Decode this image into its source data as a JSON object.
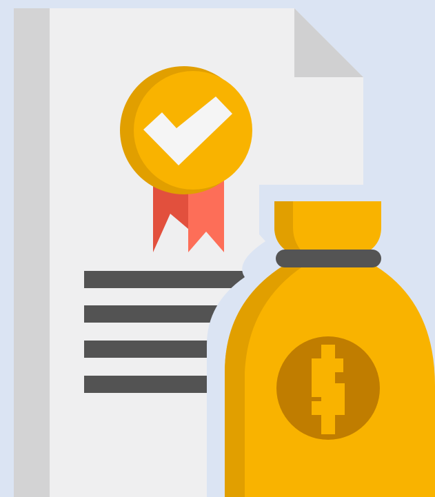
{
  "illustration": {
    "icons": [
      "certificate-document-icon",
      "approval-check-badge-icon",
      "ribbon-icon",
      "money-bag-icon",
      "dollar-coin-icon"
    ],
    "text_lines_on_document": 4,
    "colors": {
      "background": "#dbe4f3",
      "paper": "#efeff0",
      "paper_spine": "#d3d3d4",
      "paper_fold": "#d0d0d1",
      "text_line": "#535353",
      "badge_gold": "#f9b300",
      "badge_gold_shadow": "#e19f00",
      "check_white": "#f5f5f5",
      "ribbon_light": "#fd6e58",
      "ribbon_dark": "#e2503d",
      "bag_gold": "#f9b300",
      "bag_gold_shadow": "#e19f00",
      "bag_tie": "#545454",
      "coin_brown": "#c07d00",
      "dollar_gold": "#f9b300"
    }
  }
}
